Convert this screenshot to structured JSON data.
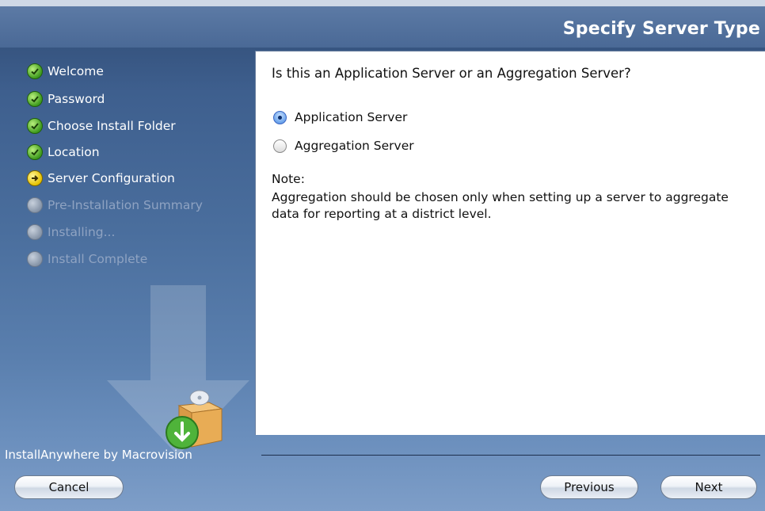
{
  "window": {
    "title": "Specify Server Type"
  },
  "sidebar": {
    "steps": [
      {
        "label": "Welcome",
        "state": "done",
        "icon": "check-circle-icon"
      },
      {
        "label": "Password",
        "state": "done",
        "icon": "check-circle-icon"
      },
      {
        "label": "Choose Install Folder",
        "state": "done",
        "icon": "check-circle-icon"
      },
      {
        "label": "Location",
        "state": "done",
        "icon": "check-circle-icon"
      },
      {
        "label": "Server Configuration",
        "state": "current",
        "icon": "arrow-circle-icon"
      },
      {
        "label": "Pre-Installation Summary",
        "state": "pending",
        "icon": "pending-circle-icon"
      },
      {
        "label": "Installing...",
        "state": "pending",
        "icon": "pending-circle-icon"
      },
      {
        "label": "Install Complete",
        "state": "pending",
        "icon": "pending-circle-icon"
      }
    ]
  },
  "content": {
    "question": "Is this an Application Server or an Aggregation Server?",
    "options": [
      {
        "label": "Application Server",
        "selected": true
      },
      {
        "label": "Aggregation Server",
        "selected": false
      }
    ],
    "note_title": "Note:",
    "note_text": "Aggregation should be chosen only when setting up a server to aggregate data for reporting at a district level."
  },
  "footer": {
    "brand": "InstallAnywhere by Macrovision",
    "cancel_label": "Cancel",
    "previous_label": "Previous",
    "next_label": "Next"
  },
  "colors": {
    "sidebar_bg": "#4a6e9d",
    "done": "#3e9a1d",
    "current": "#e6c200",
    "pending": "#8795a8"
  }
}
